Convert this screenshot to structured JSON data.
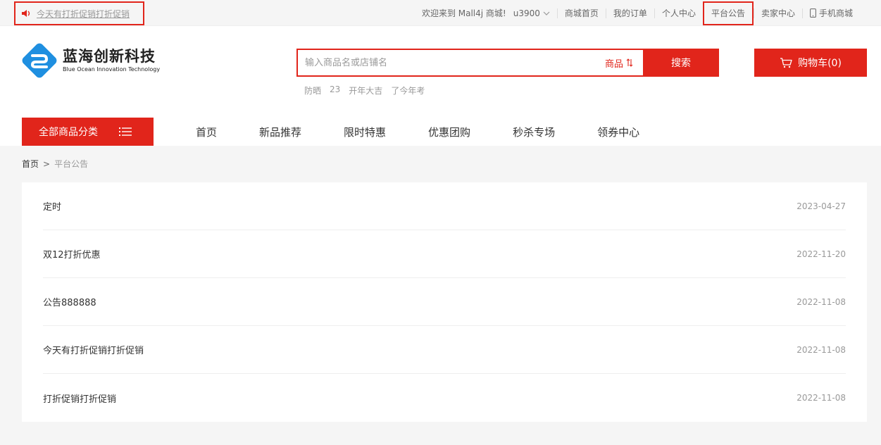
{
  "topbar": {
    "notice": "今天有打折促销打折促销",
    "welcome": "欢迎来到 Mall4j 商城!",
    "user": "u3900",
    "links": [
      "商城首页",
      "我的订单",
      "个人中心",
      "平台公告",
      "卖家中心",
      "手机商城"
    ]
  },
  "logo": {
    "cn": "蓝海创新科技",
    "en": "Blue Ocean Innovation Technology"
  },
  "search": {
    "placeholder": "输入商品名或店铺名",
    "type": "商品",
    "button": "搜索",
    "hot": [
      "防晒",
      "23",
      "开年大吉",
      "了今年考"
    ]
  },
  "cart": {
    "label": "购物车(0)"
  },
  "category": {
    "label": "全部商品分类"
  },
  "nav": [
    "首页",
    "新品推荐",
    "限时特惠",
    "优惠团购",
    "秒杀专场",
    "领券中心"
  ],
  "breadcrumb": {
    "home": "首页",
    "separator": ">",
    "current": "平台公告"
  },
  "notices": [
    {
      "title": "定时",
      "date": "2023-04-27"
    },
    {
      "title": "双12打折优惠",
      "date": "2022-11-20"
    },
    {
      "title": "公告888888",
      "date": "2022-11-08"
    },
    {
      "title": "今天有打折促销打折促销",
      "date": "2022-11-08"
    },
    {
      "title": "打折促销打折促销",
      "date": "2022-11-08"
    }
  ],
  "colors": {
    "accent": "#e1251b",
    "logo_blue": "#1f8fe0"
  }
}
